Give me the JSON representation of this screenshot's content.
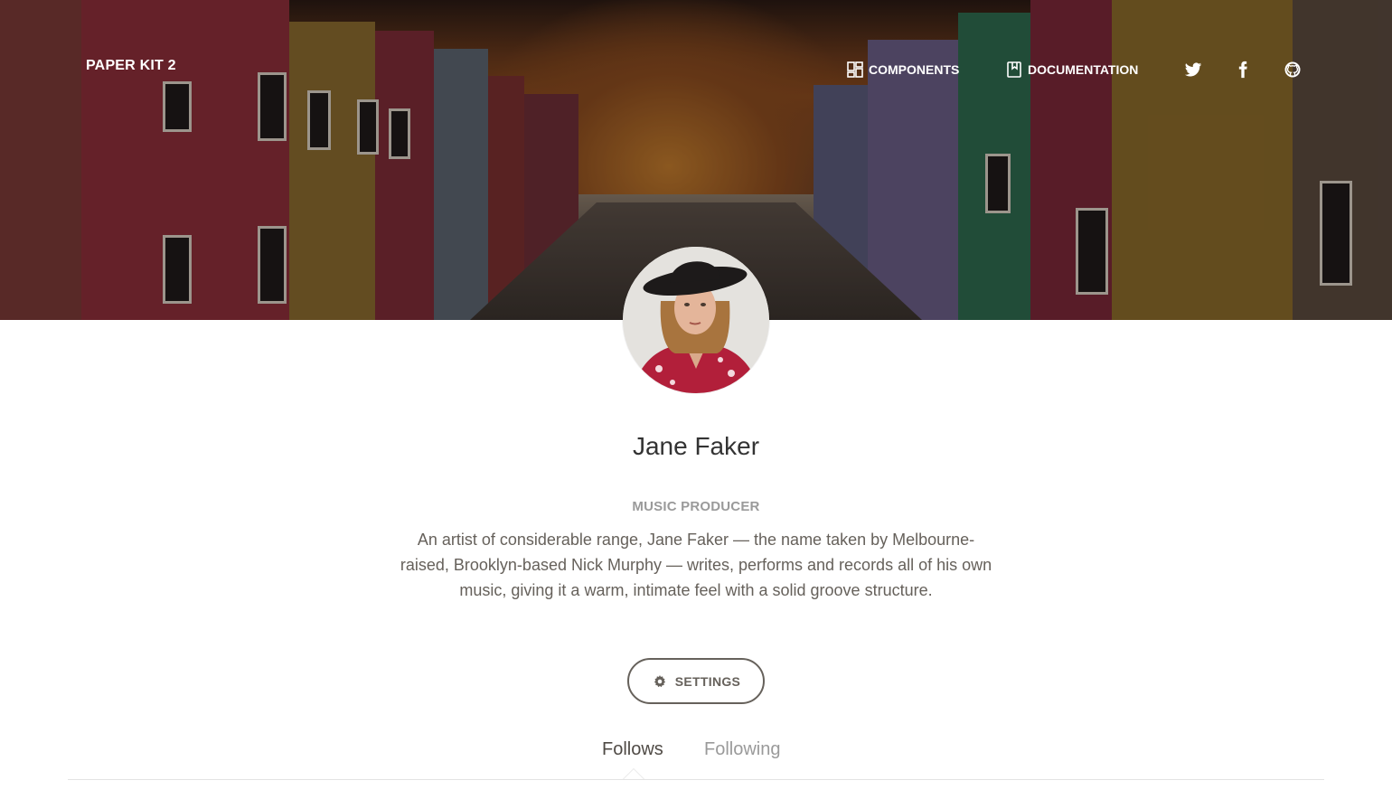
{
  "navbar": {
    "brand": "PAPER KIT 2",
    "items": [
      {
        "label": "COMPONENTS",
        "icon": "layout-icon"
      },
      {
        "label": "DOCUMENTATION",
        "icon": "book-icon"
      }
    ],
    "social": [
      "twitter-icon",
      "facebook-icon",
      "github-icon"
    ]
  },
  "profile": {
    "name": "Jane Faker",
    "role": "MUSIC PRODUCER",
    "bio": "An artist of considerable range, Jane Faker — the name taken by Melbourne-raised, Brooklyn-based Nick Murphy — writes, performs and records all of his own music, giving it a warm, intimate feel with a solid groove structure.",
    "settings_label": "SETTINGS",
    "settings_icon": "gear-icon"
  },
  "tabs": [
    {
      "label": "Follows",
      "active": true
    },
    {
      "label": "Following",
      "active": false
    }
  ],
  "colors": {
    "text": "#66615b",
    "muted": "#9a9a9a",
    "divider": "#e3e3e3"
  }
}
